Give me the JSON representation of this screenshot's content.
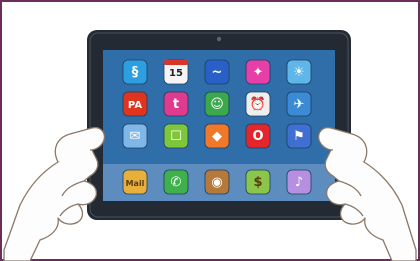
{
  "scene": {
    "frame_color": "#6b2d5c",
    "background": "#ffffff",
    "skin_color": "#fdfdfd",
    "skin_outline": "#8a7868",
    "tablet_bezel": "#232a33",
    "screen_color": "#2f6ea8",
    "dock_color": "#5d8dbf"
  },
  "apps": [
    {
      "name": "spring-app-icon",
      "color": "#2d9fe0",
      "glyph": "§"
    },
    {
      "name": "calendar-app-icon",
      "color": "#f4f4f4",
      "glyph": "15",
      "label": "15"
    },
    {
      "name": "dolphin-app-icon",
      "color": "#2960c8",
      "glyph": "~"
    },
    {
      "name": "satellite-app-icon",
      "color": "#e63fa7",
      "glyph": "✦"
    },
    {
      "name": "weather-app-icon",
      "color": "#5fb6e8",
      "glyph": "☀"
    },
    {
      "name": "pa-app-icon",
      "color": "#e0341f",
      "glyph": "PA",
      "label": "PA"
    },
    {
      "name": "tumblr-app-icon",
      "color": "#e03a8e",
      "glyph": "t"
    },
    {
      "name": "ghost-app-icon",
      "color": "#3aa84b",
      "glyph": "☺"
    },
    {
      "name": "alarm-clock-app-icon",
      "color": "#eeeeee",
      "glyph": "⏰"
    },
    {
      "name": "bird-app-icon",
      "color": "#3a8ad6",
      "glyph": "✈"
    },
    {
      "name": "mail-envelope-app-icon",
      "color": "#7fb8e8",
      "glyph": "✉"
    },
    {
      "name": "robot-app-icon",
      "color": "#7ec63a",
      "glyph": "☐"
    },
    {
      "name": "candy-app-icon",
      "color": "#f0782a",
      "glyph": "◆"
    },
    {
      "name": "opera-app-icon",
      "color": "#e3262c",
      "glyph": "O"
    },
    {
      "name": "flag-app-icon",
      "color": "#3f6fd0",
      "glyph": "⚑"
    }
  ],
  "dock": [
    {
      "name": "mail-app-icon",
      "color": "#e8b03a",
      "glyph": "Mail",
      "label": "Mail"
    },
    {
      "name": "phone-app-icon",
      "color": "#3fb04b",
      "glyph": "✆"
    },
    {
      "name": "camera-app-icon",
      "color": "#b5793b",
      "glyph": "◉"
    },
    {
      "name": "money-app-icon",
      "color": "#8ac64a",
      "glyph": "$"
    },
    {
      "name": "music-app-icon",
      "color": "#b78fe0",
      "glyph": "♪"
    }
  ]
}
